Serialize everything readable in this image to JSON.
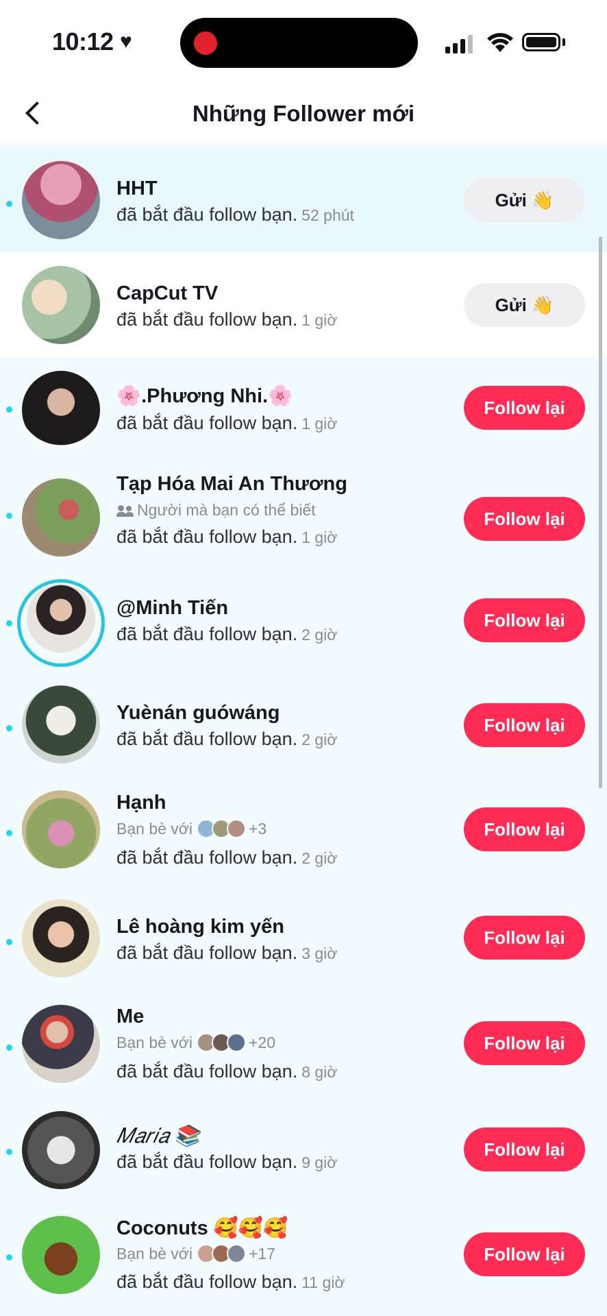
{
  "status_bar": {
    "time": "10:12",
    "heart": "♥"
  },
  "header": {
    "title": "Những Follower mới",
    "back_icon": "chevron-left-icon"
  },
  "colors": {
    "follow_button": "#fe2c55",
    "unread_dot": "#20d5ec",
    "send_button": "#efeff1"
  },
  "followers": [
    {
      "name": "HHT",
      "desc": "đã bắt đầu follow bạn.",
      "time": "52 phút",
      "button": "Gửi 👋",
      "button_type": "send",
      "unread": true
    },
    {
      "name": "CapCut TV",
      "desc": "đã bắt đầu follow bạn.",
      "time": "1 giờ",
      "button": "Gửi 👋",
      "button_type": "send",
      "unread": false
    },
    {
      "name": "🌸.Phương Nhi.🌸",
      "desc": "đã bắt đầu follow bạn.",
      "time": "1 giờ",
      "button": "Follow lại",
      "button_type": "follow",
      "unread": true
    },
    {
      "name": "Tạp Hóa Mai An Thương",
      "sub": "Người mà bạn có thể biết",
      "desc": "đã bắt đầu follow bạn.",
      "time": "1 giờ",
      "button": "Follow lại",
      "button_type": "follow",
      "unread": true
    },
    {
      "name": "@Minh Tiến",
      "desc": "đã bắt đầu follow bạn.",
      "time": "2 giờ",
      "button": "Follow lại",
      "button_type": "follow",
      "unread": true
    },
    {
      "name": "Yuènán guówáng",
      "desc": "đã bắt đầu follow bạn.",
      "time": "2 giờ",
      "button": "Follow lại",
      "button_type": "follow",
      "unread": true
    },
    {
      "name": "Hạnh",
      "sub": "Bạn bè với",
      "sub_count": "+3",
      "desc": "đã bắt đầu follow bạn.",
      "time": "2 giờ",
      "button": "Follow lại",
      "button_type": "follow",
      "unread": true
    },
    {
      "name": "Lê hoàng kim yến",
      "desc": "đã bắt đầu follow bạn.",
      "time": "3 giờ",
      "button": "Follow lại",
      "button_type": "follow",
      "unread": true
    },
    {
      "name": "Me",
      "sub": "Bạn bè với",
      "sub_count": "+20",
      "desc": "đã bắt đầu follow bạn.",
      "time": "8 giờ",
      "button": "Follow lại",
      "button_type": "follow",
      "unread": true
    },
    {
      "name": "𝑀𝑎𝑟𝑖𝑎 📚",
      "desc": "đã bắt đầu follow bạn.",
      "time": "9 giờ",
      "button": "Follow lại",
      "button_type": "follow",
      "unread": true
    },
    {
      "name": "Coconuts 🥰🥰🥰",
      "sub": "Bạn bè với",
      "sub_count": "+17",
      "desc": "đã bắt đầu follow bạn.",
      "time": "11 giờ",
      "button": "Follow lại",
      "button_type": "follow",
      "unread": true
    }
  ]
}
